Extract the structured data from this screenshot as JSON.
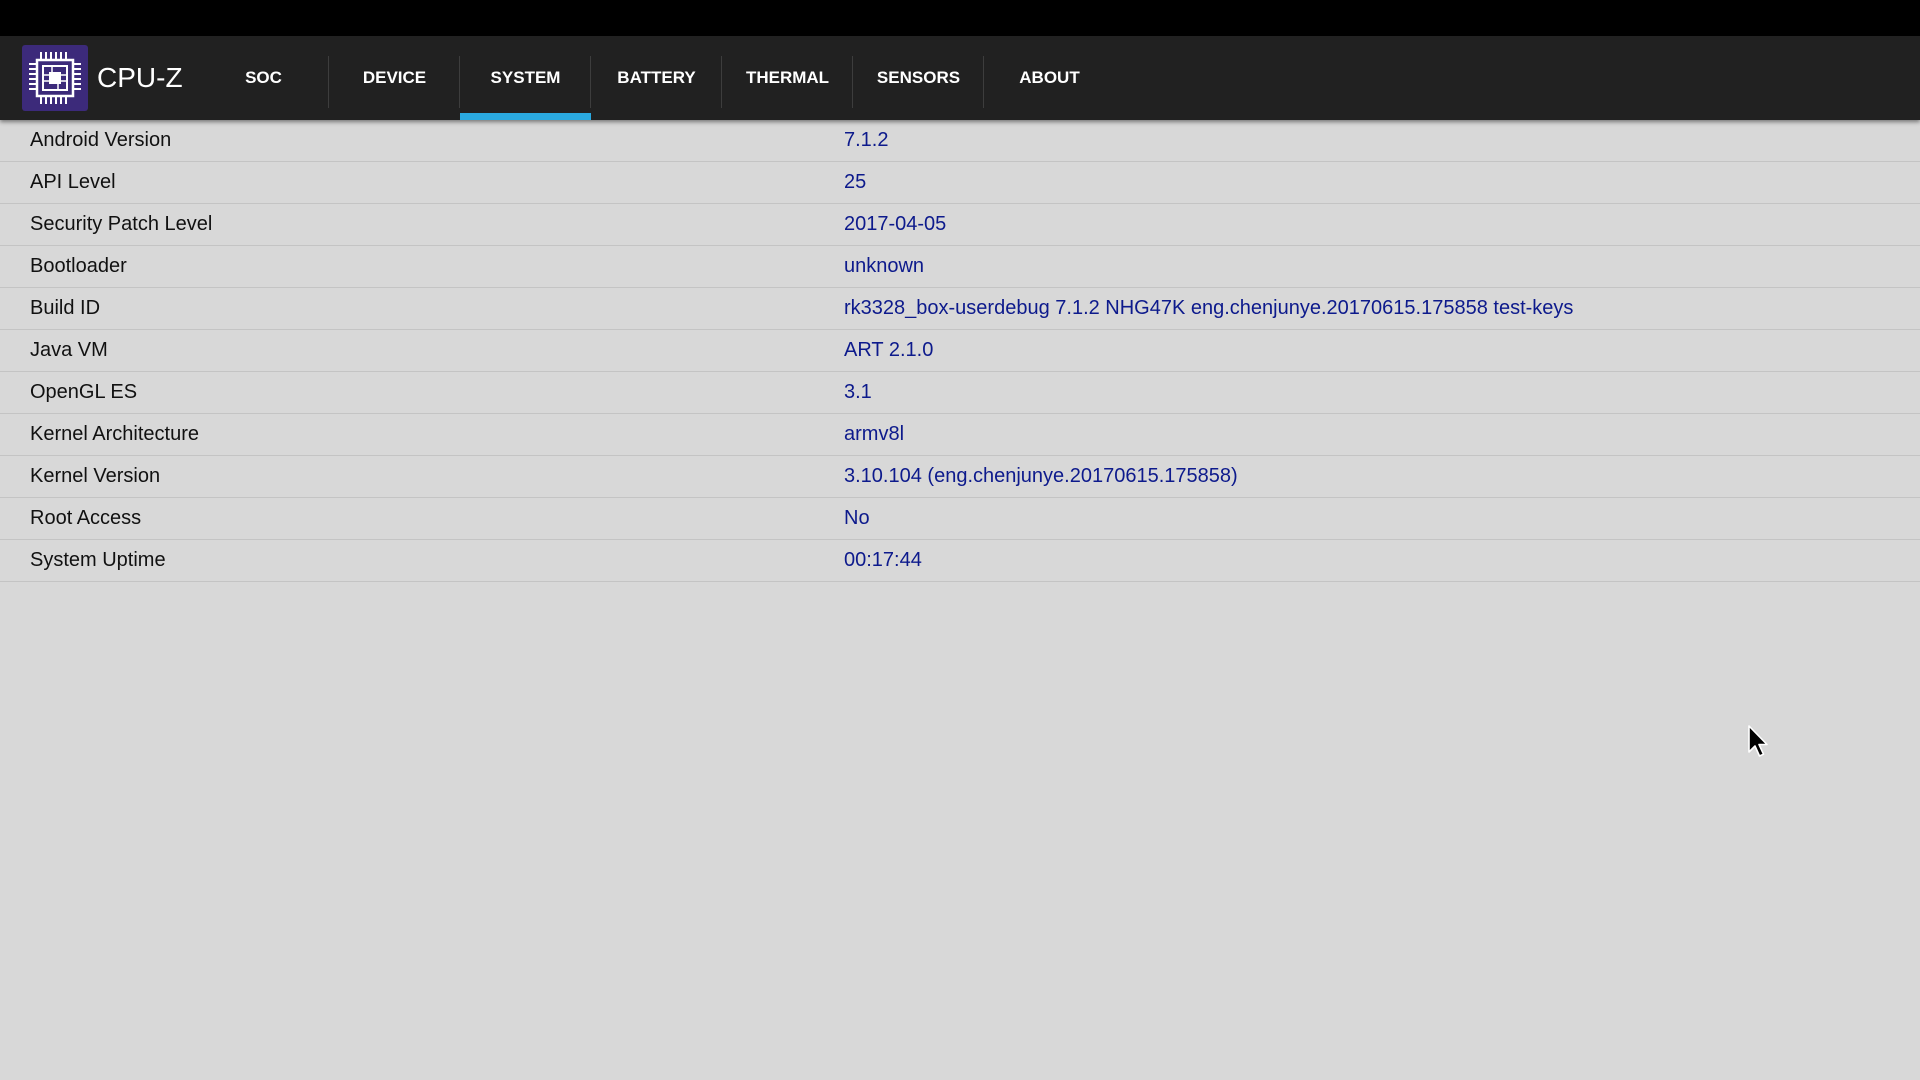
{
  "app": {
    "title": "CPU-Z",
    "logo_icon": "cpu-chip-icon"
  },
  "tabs": [
    {
      "label": "SOC",
      "active": false
    },
    {
      "label": "DEVICE",
      "active": false
    },
    {
      "label": "SYSTEM",
      "active": true
    },
    {
      "label": "BATTERY",
      "active": false
    },
    {
      "label": "THERMAL",
      "active": false
    },
    {
      "label": "SENSORS",
      "active": false
    },
    {
      "label": "ABOUT",
      "active": false
    }
  ],
  "system_info": [
    {
      "label": "Android Version",
      "value": "7.1.2"
    },
    {
      "label": "API Level",
      "value": "25"
    },
    {
      "label": "Security Patch Level",
      "value": "2017-04-05"
    },
    {
      "label": "Bootloader",
      "value": "unknown"
    },
    {
      "label": "Build ID",
      "value": "rk3328_box-userdebug 7.1.2 NHG47K eng.chenjunye.20170615.175858 test-keys"
    },
    {
      "label": "Java VM",
      "value": "ART 2.1.0"
    },
    {
      "label": "OpenGL ES",
      "value": "3.1"
    },
    {
      "label": "Kernel Architecture",
      "value": "armv8l"
    },
    {
      "label": "Kernel Version",
      "value": "3.10.104 (eng.chenjunye.20170615.175858)"
    },
    {
      "label": "Root Access",
      "value": "No"
    },
    {
      "label": "System Uptime",
      "value": "00:17:44"
    }
  ],
  "colors": {
    "appbar": "#212121",
    "background": "#d8d8d8",
    "accent": "#2aa9e0",
    "value_text": "#0d1a8c",
    "logo_bg": "#3c2a7a"
  },
  "cursor_icon": "mouse-pointer-icon"
}
